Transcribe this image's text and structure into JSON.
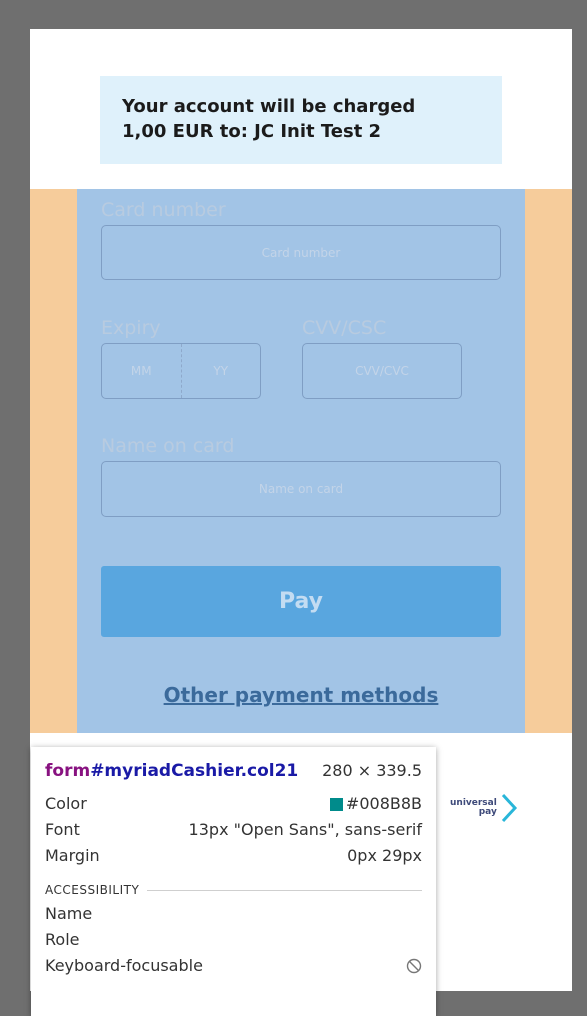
{
  "banner": {
    "line1": "Your account will be charged",
    "line2": "1,00 EUR to: JC Init Test 2"
  },
  "form": {
    "card_number": {
      "label": "Card number",
      "placeholder": "Card number"
    },
    "expiry": {
      "label": "Expiry",
      "month_placeholder": "MM",
      "year_placeholder": "YY"
    },
    "cvv": {
      "label": "CVV/CSC",
      "placeholder": "CVV/CVC"
    },
    "name": {
      "label": "Name on card",
      "placeholder": "Name on card"
    },
    "pay_label": "Pay",
    "other_methods_label": "Other payment methods"
  },
  "logo": {
    "line1": "universal",
    "line2": "pay"
  },
  "inspector": {
    "selector_tag": "form",
    "selector_rest": "#myriadCashier.col21",
    "size": "280 × 339.5",
    "rows": [
      {
        "key": "Color",
        "value": "#008B8B"
      },
      {
        "key": "Font",
        "value": "13px \"Open Sans\", sans-serif"
      },
      {
        "key": "Margin",
        "value": "0px 29px"
      }
    ],
    "accessibility_title": "ACCESSIBILITY",
    "a11y_rows": [
      {
        "key": "Name",
        "value": ""
      },
      {
        "key": "Role",
        "value": ""
      },
      {
        "key": "Keyboard-focusable",
        "value": ""
      }
    ]
  },
  "colors": {
    "margin_overlay": "#f6cc9b",
    "content_overlay": "#a2c4e6",
    "pay_button": "#59a6df",
    "swatch": "#008B8B"
  }
}
